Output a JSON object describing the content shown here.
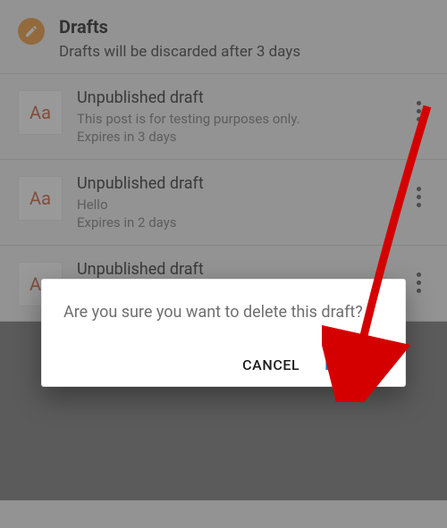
{
  "header": {
    "title": "Drafts",
    "subtitle": "Drafts will be discarded after 3 days",
    "thumb_glyph": "Aa"
  },
  "drafts": [
    {
      "title": "Unpublished draft",
      "snippet": "This post is for testing purposes only.",
      "expires": "Expires in 3 days"
    },
    {
      "title": "Unpublished draft",
      "snippet": "Hello",
      "expires": "Expires in 2 days"
    },
    {
      "title": "Unpublished draft",
      "snippet": "",
      "expires": ""
    }
  ],
  "dialog": {
    "message": "Are you sure you want to delete this draft?",
    "cancel_label": "CANCEL",
    "delete_label": "DELETE"
  },
  "colors": {
    "accent_orange": "#ef9733",
    "thumb_text": "#ce5530",
    "delete_blue": "#1976d2"
  }
}
